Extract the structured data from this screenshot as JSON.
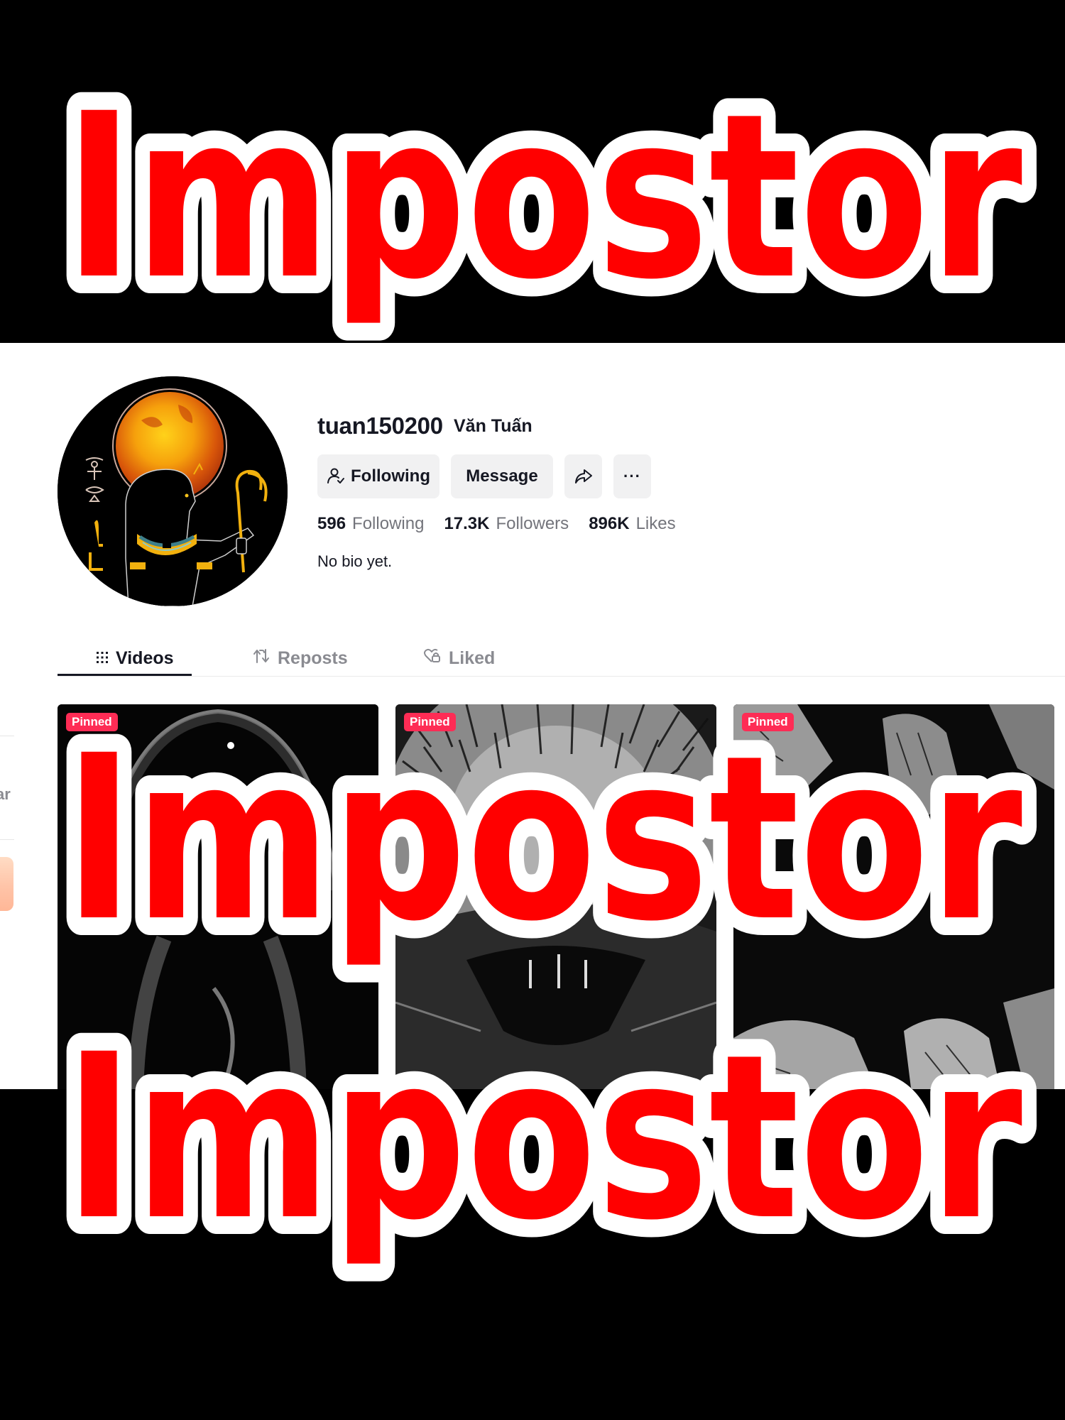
{
  "overlay": {
    "caption_lines": [
      "Impostor",
      "Impostor",
      "Impostor"
    ],
    "text_color": "#FF0000",
    "outline_color": "#FFFFFF"
  },
  "profile": {
    "username": "tuan150200",
    "nickname": "Văn Tuấn",
    "avatar_icon": "egyptian-deity-avatar",
    "buttons": {
      "following_label": "Following",
      "following_icon": "user-check-icon",
      "message_label": "Message",
      "share_icon": "share-arrow-icon",
      "more_icon": "more-dots-icon",
      "more_glyph": "···"
    },
    "stats": [
      {
        "value": "596",
        "label": "Following"
      },
      {
        "value": "17.3K",
        "label": "Followers"
      },
      {
        "value": "896K",
        "label": "Likes"
      }
    ],
    "bio": "No bio yet."
  },
  "tabs": [
    {
      "label": "Videos",
      "icon": "grid-icon",
      "active": true
    },
    {
      "label": "Reposts",
      "icon": "repost-icon",
      "active": false
    },
    {
      "label": "Liked",
      "icon": "heart-lock-icon",
      "active": false
    }
  ],
  "videos": [
    {
      "badge": "Pinned",
      "thumbnail": "dark-abstract-smoke"
    },
    {
      "badge": "Pinned",
      "thumbnail": "sketch-creature-mouth"
    },
    {
      "badge": "Pinned",
      "thumbnail": "sketch-hands"
    }
  ],
  "sidebar_fragment": {
    "partial_text": "ar"
  },
  "colors": {
    "accent": "#FE2C55",
    "text_primary": "#161823",
    "text_secondary": "#73747B",
    "button_bg": "#F1F1F2"
  }
}
